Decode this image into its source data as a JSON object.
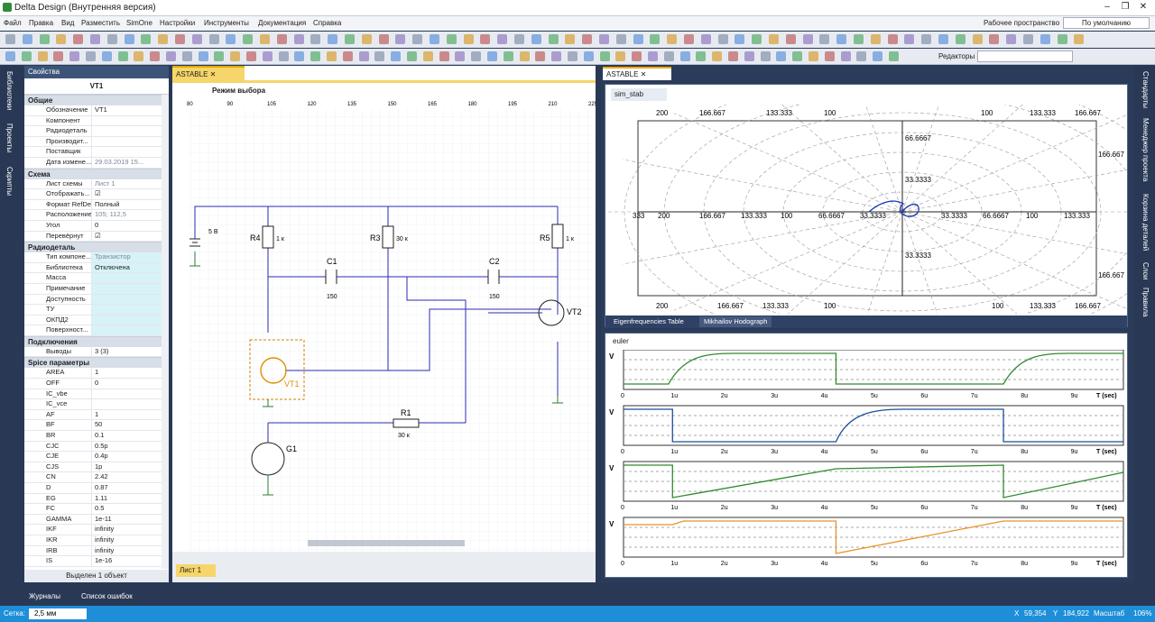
{
  "app": {
    "title": "Delta Design (Внутренняя версия)"
  },
  "menu": [
    "Файл",
    "Правка",
    "Вид",
    "Разместить",
    "SimOne",
    "Настройки",
    "Инструменты",
    "Документация",
    "Справка"
  ],
  "workspace": {
    "label": "Рабочее пространство",
    "value": "По умолчанию"
  },
  "editors": {
    "label": "Редакторы"
  },
  "left_rail": [
    "Библиотеки",
    "Проекты",
    "Скрипты"
  ],
  "right_rail": [
    "Стандарты",
    "Менеджер проекта",
    "Корзина деталей",
    "Слои",
    "Правила"
  ],
  "properties": {
    "title": "Свойства",
    "object": "VT1",
    "footer": "Выделен 1 объект",
    "sections": [
      {
        "name": "Общие",
        "rows": [
          [
            "Обозначение",
            "VT1"
          ],
          [
            "Компонент",
            ""
          ],
          [
            "Радиодеталь",
            ""
          ],
          [
            "Производит...",
            ""
          ],
          [
            "Поставщик",
            ""
          ],
          [
            "Дата измене...",
            "29.03.2019 15..."
          ]
        ]
      },
      {
        "name": "Схема",
        "rows": [
          [
            "Лист схемы",
            "Лист 1"
          ],
          [
            "Отображать...",
            "☑"
          ],
          [
            "Формат RefDes",
            "Полный"
          ],
          [
            "Расположение",
            "105; 112,5"
          ],
          [
            "Угол",
            "0"
          ],
          [
            "Перевёрнут",
            "☑"
          ]
        ]
      },
      {
        "name": "Радиодеталь",
        "rows": [
          [
            "Тип компоне...",
            "Транзистор"
          ],
          [
            "Библиотека",
            "Отключена"
          ],
          [
            "Масса",
            ""
          ],
          [
            "Примечание",
            ""
          ],
          [
            "Доступность",
            ""
          ],
          [
            "ТУ",
            ""
          ],
          [
            "ОКПД2",
            ""
          ],
          [
            "Поверхност...",
            ""
          ]
        ]
      },
      {
        "name": "Подключения",
        "rows": [
          [
            "Выводы",
            "3 (3)"
          ]
        ]
      },
      {
        "name": "Spice параметры",
        "rows": [
          [
            "AREA",
            "1"
          ],
          [
            "OFF",
            "0"
          ],
          [
            "IC_vbe",
            ""
          ],
          [
            "IC_vce",
            ""
          ],
          [
            "AF",
            "1"
          ],
          [
            "BF",
            "50"
          ],
          [
            "BR",
            "0.1"
          ],
          [
            "CJC",
            "0.5p"
          ],
          [
            "CJE",
            "0.4p"
          ],
          [
            "CJS",
            "1p"
          ],
          [
            "CN",
            "2.42"
          ],
          [
            "D",
            "0.87"
          ],
          [
            "EG",
            "1.11"
          ],
          [
            "FC",
            "0.5"
          ],
          [
            "GAMMA",
            "1e-11"
          ],
          [
            "IKF",
            "infinity"
          ],
          [
            "IKR",
            "infinity"
          ],
          [
            "IRB",
            "infinity"
          ],
          [
            "IS",
            "1e-16"
          ]
        ]
      }
    ]
  },
  "schematic": {
    "tab": "ASTABLE",
    "mode": "Режим выбора",
    "sheet": "Лист 1",
    "ruler": [
      "80",
      "90",
      "105",
      "120",
      "135",
      "150",
      "165",
      "180",
      "195",
      "210",
      "225"
    ],
    "labels": {
      "r4": "R4",
      "r4v": "1 к",
      "r3": "R3",
      "r3v": "30 к",
      "r5": "R5",
      "r5v": "1 к",
      "c1": "C1",
      "c1v": "150",
      "c2": "C2",
      "c2v": "150",
      "vt1": "VT1",
      "vt2": "VT2",
      "r1": "R1",
      "r1v": "30 к",
      "g1": "G1",
      "bat": "5 В"
    }
  },
  "graph": {
    "tab": "ASTABLE",
    "sim_tab": "sim_stab",
    "bottom_tabs": [
      "Eigenfrequencies Table",
      "Mikhailov Hodograph"
    ],
    "top_ticks": [
      "200",
      "166.667",
      "133.333",
      "100",
      "100",
      "133.333",
      "166.667"
    ],
    "mid_ticks": [
      "333",
      "200",
      "166.667",
      "133.333",
      "100",
      "66.6667",
      "33.3333",
      "33.3333",
      "66.6667",
      "100",
      "133.333"
    ],
    "right_ticks": [
      "166.667",
      "166.667"
    ],
    "v_ticks": [
      "66.6667",
      "33.3333",
      "33.3333"
    ]
  },
  "euler": {
    "tab": "euler",
    "xlabel": "T (sec)",
    "xticks": [
      "0",
      "1u",
      "2u",
      "3u",
      "4u",
      "5u",
      "6u",
      "7u",
      "8u",
      "9u"
    ]
  },
  "logs": [
    "Журналы",
    "Список ошибок"
  ],
  "status": {
    "grid_label": "Сетка:",
    "grid_value": "2,5 мм",
    "x_label": "X",
    "x": "59,354",
    "y_label": "Y",
    "y": "184,922",
    "zoom_label": "Масштаб",
    "zoom": "106%"
  }
}
